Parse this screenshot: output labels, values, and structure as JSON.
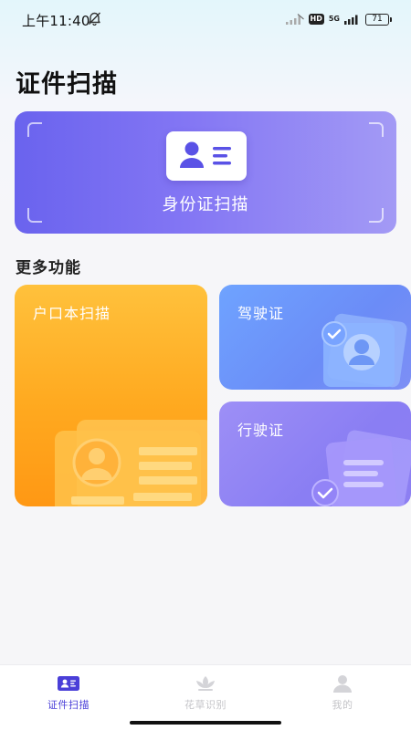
{
  "status_bar": {
    "time": "上午11:40",
    "bell_icon": "bell-off-icon",
    "hd_badge": "HD",
    "network": "5G",
    "battery": "71"
  },
  "page": {
    "title": "证件扫描"
  },
  "id_scan": {
    "label": "身份证扫描",
    "icon": "id-card-icon"
  },
  "more": {
    "title": "更多功能",
    "items": [
      {
        "label": "户口本扫描"
      },
      {
        "label": "驾驶证"
      },
      {
        "label": "行驶证"
      }
    ]
  },
  "tab_bar": {
    "tabs": [
      {
        "label": "证件扫描",
        "icon": "id-card-icon",
        "active": true
      },
      {
        "label": "花草识别",
        "icon": "lotus-icon",
        "active": false
      },
      {
        "label": "我的",
        "icon": "user-icon",
        "active": false
      }
    ]
  },
  "colors": {
    "accent": "#4a3fd8",
    "id_card_gradient": [
      "#6a63ee",
      "#a39af5"
    ],
    "hukou_gradient": [
      "#ffc13c",
      "#ff9814"
    ],
    "jiashi_gradient": [
      "#6fa3ff",
      "#7d8ff5"
    ],
    "xingshi_gradient": [
      "#9d8ff6",
      "#8d7ff2"
    ]
  }
}
